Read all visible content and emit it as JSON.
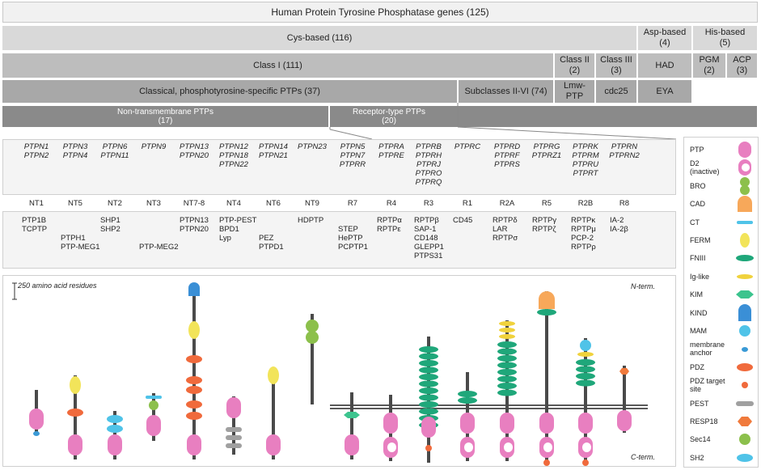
{
  "title": "Human Protein Tyrosine Phosphatase genes (125)",
  "row1": [
    {
      "label": "Cys-based (116)"
    },
    {
      "label": "Asp-based\n(4)"
    },
    {
      "label": "His-based\n(5)"
    }
  ],
  "row2": [
    {
      "label": "Class I (111)"
    },
    {
      "label": "Class II\n(2)"
    },
    {
      "label": "Class III\n(3)"
    },
    {
      "label": "HAD"
    },
    {
      "label": "PGM\n(2)"
    },
    {
      "label": "ACP\n(3)"
    }
  ],
  "row3": [
    {
      "label": "Classical, phosphotyrosine-specific PTPs (37)"
    },
    {
      "label": "Subclasses II-VI (74)"
    },
    {
      "label": "Lmw-\nPTP"
    },
    {
      "label": "cdc25"
    },
    {
      "label": "EYA"
    }
  ],
  "row4": [
    {
      "label": "Non-transmembrane PTPs\n(17)"
    },
    {
      "label": "Receptor-type PTPs\n(20)"
    }
  ],
  "columns": [
    {
      "genes": "PTPN1\nPTPN2",
      "sub": "NT1",
      "proteins": "PTP1B\nTCPTP"
    },
    {
      "genes": "PTPN3\nPTPN4",
      "sub": "NT5",
      "proteins": "\n\nPTPH1\nPTP-MEG1"
    },
    {
      "genes": "PTPN6\nPTPN11",
      "sub": "NT2",
      "proteins": "SHP1\nSHP2"
    },
    {
      "genes": "PTPN9",
      "sub": "NT3",
      "proteins": "\n\n\nPTP-MEG2"
    },
    {
      "genes": "PTPN13\nPTPN20",
      "sub": "NT7-8",
      "proteins": "PTPN13\nPTPN20"
    },
    {
      "genes": "PTPN12\nPTPN18\nPTPN22",
      "sub": "NT4",
      "proteins": "PTP-PEST\nBPD1\nLyp"
    },
    {
      "genes": "PTPN14\nPTPN21",
      "sub": "NT6",
      "proteins": "\n\nPEZ\nPTPD1"
    },
    {
      "genes": "PTPN23",
      "sub": "NT9",
      "proteins": "HDPTP"
    },
    {
      "genes": "PTPN5\nPTPN7\nPTPRR",
      "sub": "R7",
      "proteins": "\nSTEP\nHePTP\nPCPTP1"
    },
    {
      "genes": "PTPRA\nPTPRE",
      "sub": "R4",
      "proteins": "RPTPα\nRPTPε"
    },
    {
      "genes": "PTPRB\nPTPRH\nPTPRJ\nPTPRO\nPTPRQ",
      "sub": "R3",
      "proteins": "RPTPβ\nSAP-1\nCD148\nGLEPP1\nPTPS31"
    },
    {
      "genes": "PTPRC",
      "sub": "R1",
      "proteins": "CD45"
    },
    {
      "genes": "PTPRD\nPTPRF\nPTPRS",
      "sub": "R2A",
      "proteins": "RPTPδ\nLAR\nRPTPσ"
    },
    {
      "genes": "PTPRG\nPTPRZ1",
      "sub": "R5",
      "proteins": "RPTPγ\nRPTPζ"
    },
    {
      "genes": "PTPRK\nPTPRM\nPTPRU\nPTPRT",
      "sub": "R2B",
      "proteins": "RPTPκ\nRPTPμ\nPCP-2\nRPTPρ"
    },
    {
      "genes": "PTPRN\nPTPRN2",
      "sub": "R8",
      "proteins": "IA-2\nIA-2β"
    }
  ],
  "scale_label": "250 amino acid residues",
  "n_term": "N-term.",
  "c_term": "C-term.",
  "legend": [
    {
      "label": "PTP",
      "icon": "ptp-domain-icon",
      "color": "#e87fc0"
    },
    {
      "label": "D2\n(inactive)",
      "icon": "d2-domain-icon",
      "color": "#e87fc0"
    },
    {
      "label": "BRO",
      "icon": "bro-domain-icon",
      "color": "#8cc04c"
    },
    {
      "label": "CAD",
      "icon": "cad-domain-icon",
      "color": "#f7a85a"
    },
    {
      "label": "CT",
      "icon": "ct-domain-icon",
      "color": "#4fc3e8"
    },
    {
      "label": "FERM",
      "icon": "ferm-domain-icon",
      "color": "#f2e45a"
    },
    {
      "label": "FNIII",
      "icon": "fniii-domain-icon",
      "color": "#1fa77a"
    },
    {
      "label": "Ig-like",
      "icon": "iglike-domain-icon",
      "color": "#f0d23c"
    },
    {
      "label": "KIM",
      "icon": "kim-domain-icon",
      "color": "#3cc48e"
    },
    {
      "label": "KIND",
      "icon": "kind-domain-icon",
      "color": "#3a8fd6"
    },
    {
      "label": "MAM",
      "icon": "mam-domain-icon",
      "color": "#4fc3e8"
    },
    {
      "label": "membrane\nanchor",
      "icon": "membrane-anchor-icon",
      "color": "#3a9ad6"
    },
    {
      "label": "PDZ",
      "icon": "pdz-domain-icon",
      "color": "#f06a3c"
    },
    {
      "label": "PDZ target\nsite",
      "icon": "pdz-target-icon",
      "color": "#f06a3c"
    },
    {
      "label": "PEST",
      "icon": "pest-domain-icon",
      "color": "#a0a0a0"
    },
    {
      "label": "RESP18",
      "icon": "resp18-domain-icon",
      "color": "#f07a3c"
    },
    {
      "label": "Sec14",
      "icon": "sec14-domain-icon",
      "color": "#8cc04c"
    },
    {
      "label": "SH2",
      "icon": "sh2-domain-icon",
      "color": "#4fc3e8"
    }
  ]
}
